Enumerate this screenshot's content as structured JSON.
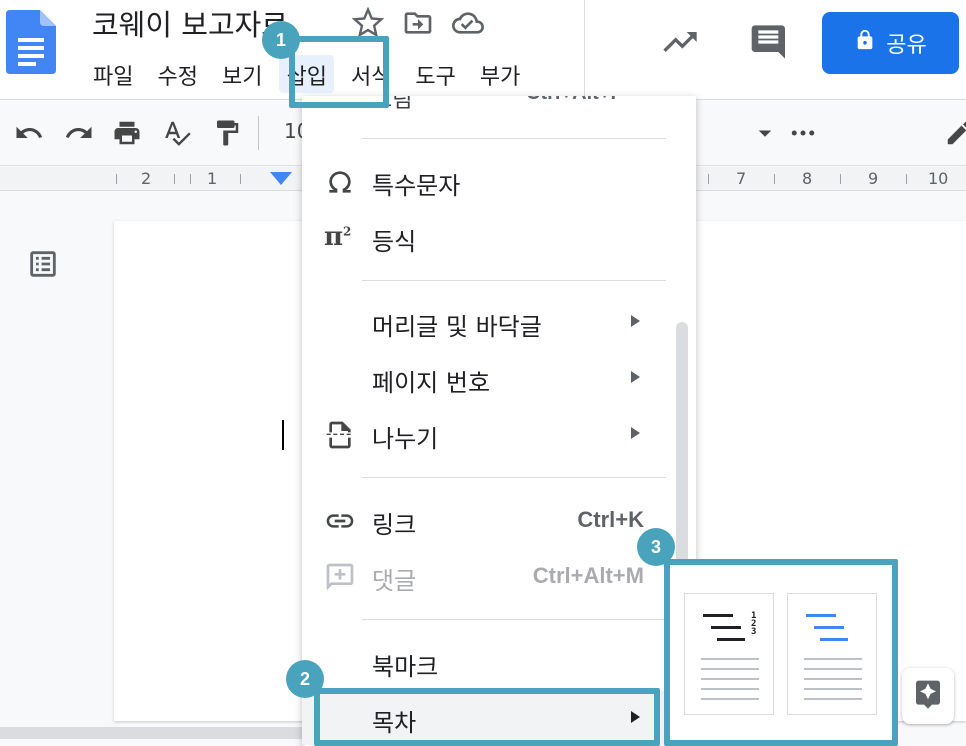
{
  "header": {
    "title": "코웨이 보고자료",
    "menus": [
      {
        "label": "파일"
      },
      {
        "label": "수정"
      },
      {
        "label": "보기"
      },
      {
        "label": "삽입"
      },
      {
        "label": "서식"
      },
      {
        "label": "도구"
      },
      {
        "label": "부가"
      }
    ],
    "share_label": "공유",
    "icons": [
      "star-icon",
      "move-to-folder-icon",
      "cloud-saved-icon",
      "trending-icon",
      "comment-icon",
      "lock-icon"
    ]
  },
  "toolbar": {
    "zoom_partial": "10",
    "icons": [
      "undo-icon",
      "redo-icon",
      "print-icon",
      "spellcheck-icon",
      "paint-format-icon",
      "dropdown-arrow-icon",
      "more-icon",
      "pencil-icon"
    ]
  },
  "ruler": {
    "numbers": [
      "2",
      "1",
      "7",
      "8",
      "9",
      "10"
    ]
  },
  "insert_menu": {
    "partial_label": "그림",
    "partial_shortcut": "Ctrl+Alt+I",
    "items": [
      {
        "label": "특수문자",
        "shortcut": "",
        "icon": "omega-icon"
      },
      {
        "label": "등식",
        "shortcut": "",
        "icon": "pi-icon"
      },
      {
        "label": "머리글 및 바닥글",
        "shortcut": "",
        "icon": ""
      },
      {
        "label": "페이지 번호",
        "shortcut": "",
        "icon": ""
      },
      {
        "label": "나누기",
        "shortcut": "",
        "icon": "page-break-icon"
      },
      {
        "label": "링크",
        "shortcut": "Ctrl+K",
        "icon": "link-icon"
      },
      {
        "label": "댓글",
        "shortcut": "Ctrl+Alt+M",
        "icon": "add-comment-icon"
      },
      {
        "label": "북마크",
        "shortcut": "",
        "icon": ""
      },
      {
        "label": "목차",
        "shortcut": "",
        "icon": ""
      }
    ]
  },
  "toc_submenu": {
    "options": [
      "toc-plain-numbers",
      "toc-blue-links"
    ],
    "accent": "#4285f4"
  },
  "callouts": [
    "1",
    "2",
    "3"
  ],
  "colors": {
    "accent": "#1a73e8",
    "callout": "#4aa3bd"
  }
}
